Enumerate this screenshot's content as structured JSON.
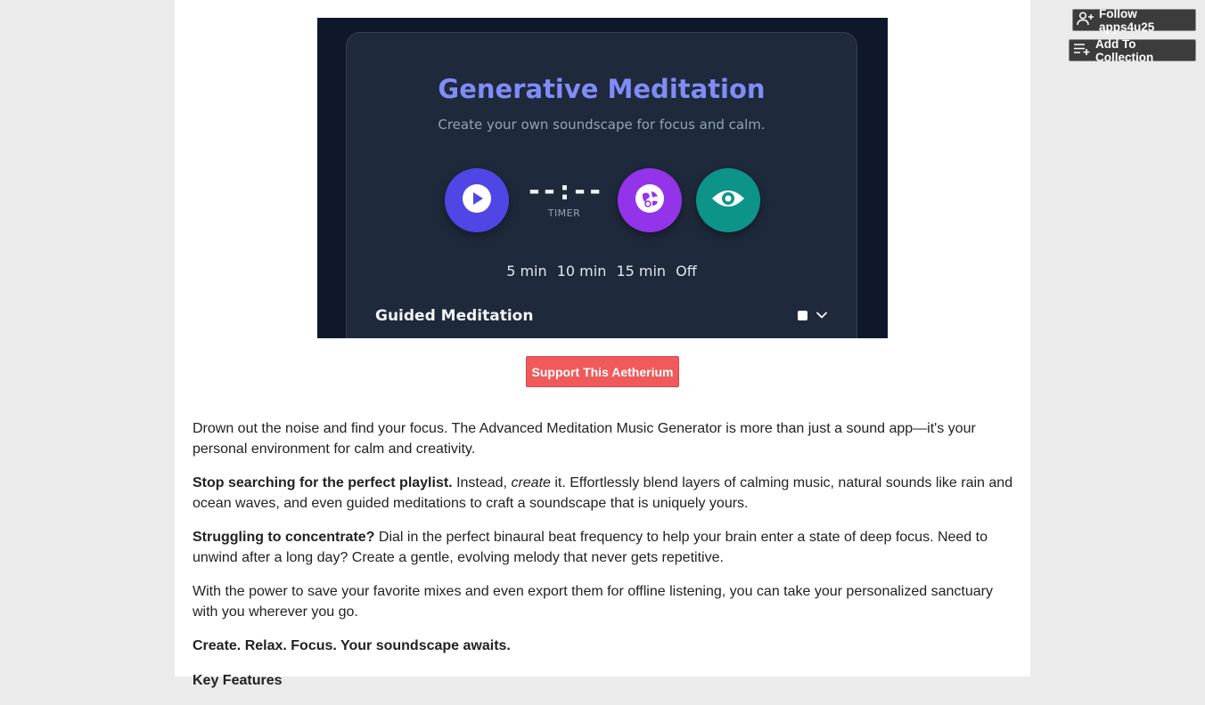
{
  "sidebar": {
    "follow_label": "Follow apps4u25",
    "collection_label": "Add To Collection"
  },
  "app_preview": {
    "title": "Generative Meditation",
    "subtitle": "Create your own soundscape for focus and calm.",
    "timer_value": "--:--",
    "timer_label": "TIMER",
    "durations": [
      "5 min",
      "10 min",
      "15 min",
      "Off"
    ],
    "section_title": "Guided Meditation",
    "icons": {
      "play": "play-icon",
      "globe": "globe-icon",
      "eye": "eye-icon",
      "chevron": "chevron-down-icon"
    },
    "colors": {
      "background": "#0f172a",
      "card": "#1e293b",
      "title": "#818cf8",
      "play_button": "#4f46e5",
      "globe_button": "#9333ea",
      "eye_button": "#0d9488"
    }
  },
  "support_button": {
    "label": "Support This Aetherium",
    "color": "#f05a5a"
  },
  "description": {
    "p1": "Drown out the noise and find your focus. The Advanced Meditation Music Generator is more than just a sound app—it's your personal environment for calm and creativity.",
    "p2_bold": "Stop searching for the perfect playlist.",
    "p2_a": " Instead, ",
    "p2_em": "create",
    "p2_b": " it. Effortlessly blend layers of calming music, natural sounds like rain and ocean waves, and even guided meditations to craft a soundscape that is uniquely yours.",
    "p3_bold": "Struggling to concentrate?",
    "p3": " Dial in the perfect binaural beat frequency to help your brain enter a state of deep focus. Need to unwind after a long day? Create a gentle, evolving melody that never gets repetitive.",
    "p4": "With the power to save your favorite mixes and even export them for offline listening, you can take your personalized sanctuary with you wherever you go.",
    "p5_bold": "Create. Relax. Focus. Your soundscape awaits.",
    "p6_bold": "Key Features"
  }
}
